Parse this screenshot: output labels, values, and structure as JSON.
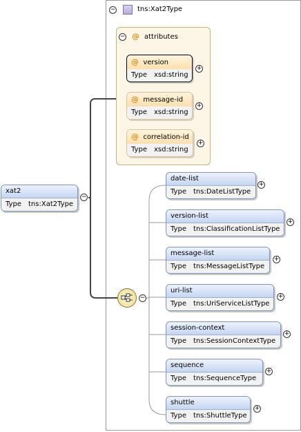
{
  "root": {
    "name": "xat2",
    "type_key": "Type",
    "type_value": "tns:Xat2Type"
  },
  "complex_type": {
    "name": "tns:Xat2Type"
  },
  "attributes_group": {
    "label": "attributes"
  },
  "attributes": [
    {
      "name": "version",
      "type_key": "Type",
      "type_value": "xsd:string"
    },
    {
      "name": "message-id",
      "type_key": "Type",
      "type_value": "xsd:string"
    },
    {
      "name": "correlation-id",
      "type_key": "Type",
      "type_value": "xsd:string"
    }
  ],
  "elements": [
    {
      "name": "date-list",
      "type_key": "Type",
      "type_value": "tns:DateListType"
    },
    {
      "name": "version-list",
      "type_key": "Type",
      "type_value": "tns:ClassificationListType"
    },
    {
      "name": "message-list",
      "type_key": "Type",
      "type_value": "tns:MessageListType"
    },
    {
      "name": "uri-list",
      "type_key": "Type",
      "type_value": "tns:UriServiceListType"
    },
    {
      "name": "session-context",
      "type_key": "Type",
      "type_value": "tns:SessionContextType"
    },
    {
      "name": "sequence",
      "type_key": "Type",
      "type_value": "tns:SequenceType"
    },
    {
      "name": "shuttle",
      "type_key": "Type",
      "type_value": "tns:ShuttleType"
    }
  ],
  "symbols": {
    "collapse": "−",
    "expand": "+",
    "attr_marker": "@"
  }
}
